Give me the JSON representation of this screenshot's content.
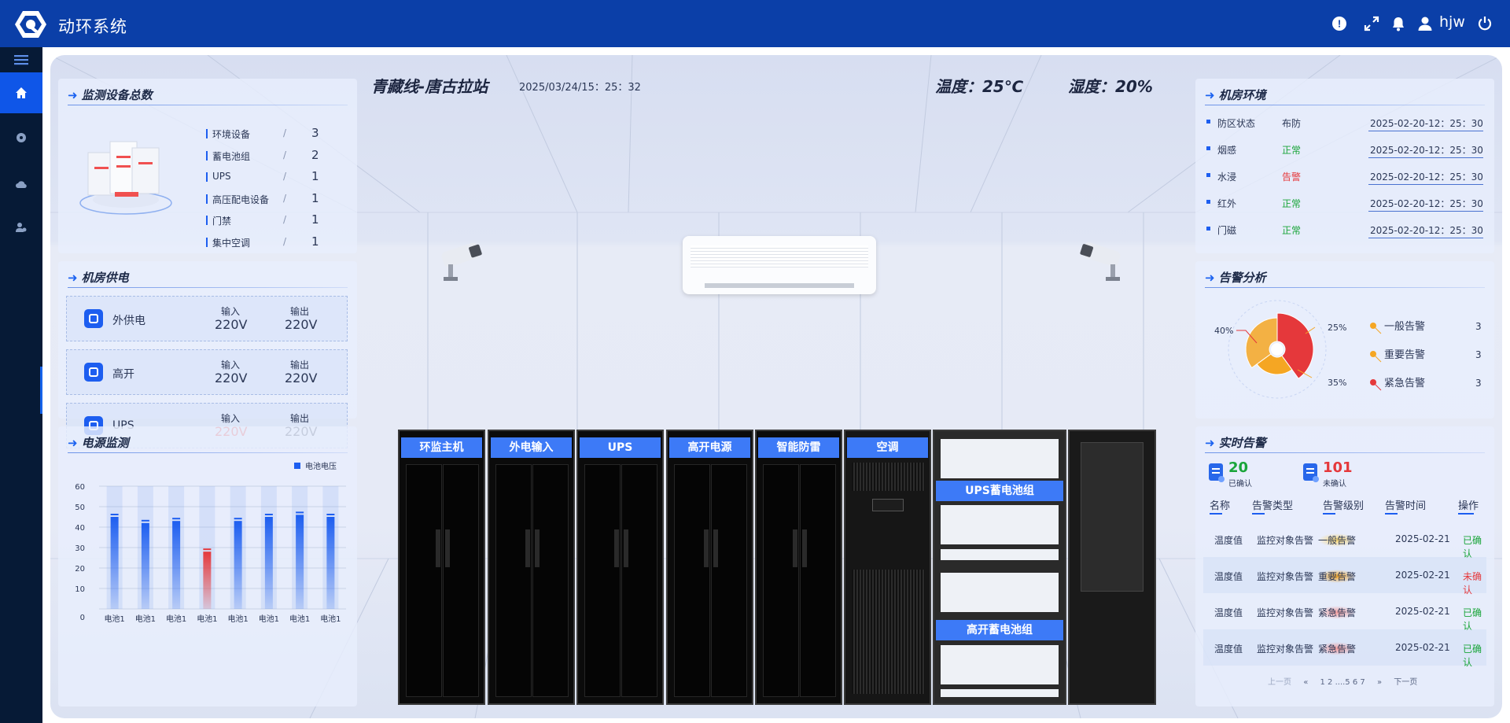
{
  "app": {
    "title": "动环系统",
    "user": "hjw"
  },
  "colors": {
    "brand": "#0b3fa8",
    "accent": "#3d7af7",
    "ok": "#1aa53a",
    "alarm": "#e5383b",
    "orange": "#f5a623"
  },
  "station": {
    "name": "青藏线-唐古拉站",
    "datetime": "2025/03/24/15：25：32",
    "temperature": "温度：25℃",
    "humidity": "湿度：20%"
  },
  "devices": {
    "title": "监测设备总数",
    "items": [
      {
        "name": "环境设备",
        "sep": "/",
        "count": "3"
      },
      {
        "name": "蓄电池组",
        "sep": "/",
        "count": "2"
      },
      {
        "name": "UPS",
        "sep": "/",
        "count": "1"
      },
      {
        "name": "高压配电设备",
        "sep": "/",
        "count": "1"
      },
      {
        "name": "门禁",
        "sep": "/",
        "count": "1"
      },
      {
        "name": "集中空调",
        "sep": "/",
        "count": "1"
      }
    ]
  },
  "power": {
    "title": "机房供电",
    "in_label": "输入",
    "out_label": "输出",
    "items": [
      {
        "name": "外供电",
        "input": "220V",
        "output": "220V"
      },
      {
        "name": "高开",
        "input": "220V",
        "output": "220V"
      },
      {
        "name": "UPS",
        "input": "220V",
        "output": "220V"
      }
    ]
  },
  "voltage_monitor": {
    "title": "电源监测",
    "legend": "电池电压"
  },
  "chart_data": {
    "type": "bar",
    "categories": [
      "电池1",
      "电池1",
      "电池1",
      "电池1",
      "电池1",
      "电池1",
      "电池1",
      "电池1"
    ],
    "series": [
      {
        "name": "电池电压",
        "values": [
          45,
          42,
          43,
          28,
          43,
          45,
          46,
          45
        ]
      }
    ],
    "highlight_index": 3,
    "ylim": [
      0,
      60
    ],
    "yticks": [
      "0",
      "10",
      "20",
      "30",
      "40",
      "50",
      "60"
    ],
    "grid": true,
    "legend_position": "top-right"
  },
  "cabinets": [
    "环监主机",
    "外电输入",
    "UPS",
    "高开电源",
    "智能防雷",
    "空调"
  ],
  "battery_racks": [
    "UPS蓄电池组",
    "高开蓄电池组"
  ],
  "environment": {
    "title": "机房环境",
    "items": [
      {
        "name": "防区状态",
        "status": "布防",
        "time": "2025-02-20-12：25：30"
      },
      {
        "name": "烟感",
        "status": "正常",
        "time": "2025-02-20-12：25：30"
      },
      {
        "name": "水浸",
        "status": "告警",
        "time": "2025-02-20-12：25：30"
      },
      {
        "name": "红外",
        "status": "正常",
        "time": "2025-02-20-12：25：30"
      },
      {
        "name": "门磁",
        "status": "正常",
        "time": "2025-02-20-12：25：30"
      }
    ]
  },
  "alarm_analysis": {
    "title": "告警分析",
    "pct_labels": [
      "40%",
      "25%",
      "35%"
    ],
    "slices": [
      {
        "name": "一般告警",
        "value": "3",
        "percent": 40
      },
      {
        "name": "重要告警",
        "value": "3",
        "percent": 25
      },
      {
        "name": "紧急告警",
        "value": "3",
        "percent": 35
      }
    ]
  },
  "realtime": {
    "title": "实时告警",
    "confirmed_count": "20",
    "confirmed_label": "已确认",
    "unconfirmed_count": "101",
    "unconfirmed_label": "未确认",
    "headers": [
      "名称",
      "告警类型",
      "告警级别",
      "告警时间",
      "操作"
    ],
    "rows": [
      {
        "name": "温度值",
        "type": "监控对象告警",
        "level": "一般告警",
        "time": "2025-02-21",
        "op": "已确认"
      },
      {
        "name": "温度值",
        "type": "监控对象告警",
        "level": "重要告警",
        "time": "2025-02-21",
        "op": "未确认"
      },
      {
        "name": "温度值",
        "type": "监控对象告警",
        "level": "紧急告警",
        "time": "2025-02-21",
        "op": "已确认"
      },
      {
        "name": "温度值",
        "type": "监控对象告警",
        "level": "紧急告警",
        "time": "2025-02-21",
        "op": "已确认"
      }
    ],
    "pagination": {
      "prev": "上一页",
      "first": "«",
      "pages": "1 2 ....5 6 7",
      "last": "»",
      "next": "下一页"
    }
  }
}
